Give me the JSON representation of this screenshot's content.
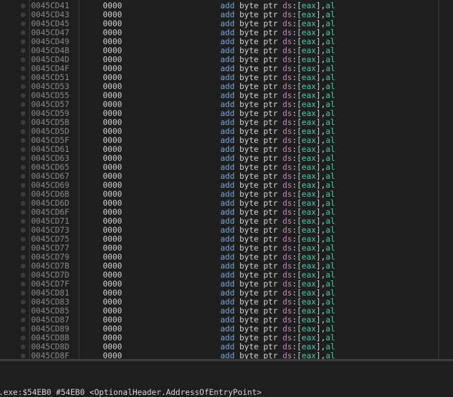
{
  "disassembly": {
    "rows": [
      {
        "address": "0045CD41",
        "bytes": "0000",
        "mnemonic": "add",
        "size": "byte",
        "ptr": "ptr",
        "segment": "ds",
        "reg": "eax",
        "src": "al"
      },
      {
        "address": "0045CD43",
        "bytes": "0000",
        "mnemonic": "add",
        "size": "byte",
        "ptr": "ptr",
        "segment": "ds",
        "reg": "eax",
        "src": "al"
      },
      {
        "address": "0045CD45",
        "bytes": "0000",
        "mnemonic": "add",
        "size": "byte",
        "ptr": "ptr",
        "segment": "ds",
        "reg": "eax",
        "src": "al"
      },
      {
        "address": "0045CD47",
        "bytes": "0000",
        "mnemonic": "add",
        "size": "byte",
        "ptr": "ptr",
        "segment": "ds",
        "reg": "eax",
        "src": "al"
      },
      {
        "address": "0045CD49",
        "bytes": "0000",
        "mnemonic": "add",
        "size": "byte",
        "ptr": "ptr",
        "segment": "ds",
        "reg": "eax",
        "src": "al"
      },
      {
        "address": "0045CD4B",
        "bytes": "0000",
        "mnemonic": "add",
        "size": "byte",
        "ptr": "ptr",
        "segment": "ds",
        "reg": "eax",
        "src": "al"
      },
      {
        "address": "0045CD4D",
        "bytes": "0000",
        "mnemonic": "add",
        "size": "byte",
        "ptr": "ptr",
        "segment": "ds",
        "reg": "eax",
        "src": "al"
      },
      {
        "address": "0045CD4F",
        "bytes": "0000",
        "mnemonic": "add",
        "size": "byte",
        "ptr": "ptr",
        "segment": "ds",
        "reg": "eax",
        "src": "al"
      },
      {
        "address": "0045CD51",
        "bytes": "0000",
        "mnemonic": "add",
        "size": "byte",
        "ptr": "ptr",
        "segment": "ds",
        "reg": "eax",
        "src": "al"
      },
      {
        "address": "0045CD53",
        "bytes": "0000",
        "mnemonic": "add",
        "size": "byte",
        "ptr": "ptr",
        "segment": "ds",
        "reg": "eax",
        "src": "al"
      },
      {
        "address": "0045CD55",
        "bytes": "0000",
        "mnemonic": "add",
        "size": "byte",
        "ptr": "ptr",
        "segment": "ds",
        "reg": "eax",
        "src": "al"
      },
      {
        "address": "0045CD57",
        "bytes": "0000",
        "mnemonic": "add",
        "size": "byte",
        "ptr": "ptr",
        "segment": "ds",
        "reg": "eax",
        "src": "al"
      },
      {
        "address": "0045CD59",
        "bytes": "0000",
        "mnemonic": "add",
        "size": "byte",
        "ptr": "ptr",
        "segment": "ds",
        "reg": "eax",
        "src": "al"
      },
      {
        "address": "0045CD5B",
        "bytes": "0000",
        "mnemonic": "add",
        "size": "byte",
        "ptr": "ptr",
        "segment": "ds",
        "reg": "eax",
        "src": "al"
      },
      {
        "address": "0045CD5D",
        "bytes": "0000",
        "mnemonic": "add",
        "size": "byte",
        "ptr": "ptr",
        "segment": "ds",
        "reg": "eax",
        "src": "al"
      },
      {
        "address": "0045CD5F",
        "bytes": "0000",
        "mnemonic": "add",
        "size": "byte",
        "ptr": "ptr",
        "segment": "ds",
        "reg": "eax",
        "src": "al"
      },
      {
        "address": "0045CD61",
        "bytes": "0000",
        "mnemonic": "add",
        "size": "byte",
        "ptr": "ptr",
        "segment": "ds",
        "reg": "eax",
        "src": "al"
      },
      {
        "address": "0045CD63",
        "bytes": "0000",
        "mnemonic": "add",
        "size": "byte",
        "ptr": "ptr",
        "segment": "ds",
        "reg": "eax",
        "src": "al"
      },
      {
        "address": "0045CD65",
        "bytes": "0000",
        "mnemonic": "add",
        "size": "byte",
        "ptr": "ptr",
        "segment": "ds",
        "reg": "eax",
        "src": "al"
      },
      {
        "address": "0045CD67",
        "bytes": "0000",
        "mnemonic": "add",
        "size": "byte",
        "ptr": "ptr",
        "segment": "ds",
        "reg": "eax",
        "src": "al"
      },
      {
        "address": "0045CD69",
        "bytes": "0000",
        "mnemonic": "add",
        "size": "byte",
        "ptr": "ptr",
        "segment": "ds",
        "reg": "eax",
        "src": "al"
      },
      {
        "address": "0045CD6B",
        "bytes": "0000",
        "mnemonic": "add",
        "size": "byte",
        "ptr": "ptr",
        "segment": "ds",
        "reg": "eax",
        "src": "al"
      },
      {
        "address": "0045CD6D",
        "bytes": "0000",
        "mnemonic": "add",
        "size": "byte",
        "ptr": "ptr",
        "segment": "ds",
        "reg": "eax",
        "src": "al"
      },
      {
        "address": "0045CD6F",
        "bytes": "0000",
        "mnemonic": "add",
        "size": "byte",
        "ptr": "ptr",
        "segment": "ds",
        "reg": "eax",
        "src": "al"
      },
      {
        "address": "0045CD71",
        "bytes": "0000",
        "mnemonic": "add",
        "size": "byte",
        "ptr": "ptr",
        "segment": "ds",
        "reg": "eax",
        "src": "al"
      },
      {
        "address": "0045CD73",
        "bytes": "0000",
        "mnemonic": "add",
        "size": "byte",
        "ptr": "ptr",
        "segment": "ds",
        "reg": "eax",
        "src": "al"
      },
      {
        "address": "0045CD75",
        "bytes": "0000",
        "mnemonic": "add",
        "size": "byte",
        "ptr": "ptr",
        "segment": "ds",
        "reg": "eax",
        "src": "al"
      },
      {
        "address": "0045CD77",
        "bytes": "0000",
        "mnemonic": "add",
        "size": "byte",
        "ptr": "ptr",
        "segment": "ds",
        "reg": "eax",
        "src": "al"
      },
      {
        "address": "0045CD79",
        "bytes": "0000",
        "mnemonic": "add",
        "size": "byte",
        "ptr": "ptr",
        "segment": "ds",
        "reg": "eax",
        "src": "al"
      },
      {
        "address": "0045CD7B",
        "bytes": "0000",
        "mnemonic": "add",
        "size": "byte",
        "ptr": "ptr",
        "segment": "ds",
        "reg": "eax",
        "src": "al"
      },
      {
        "address": "0045CD7D",
        "bytes": "0000",
        "mnemonic": "add",
        "size": "byte",
        "ptr": "ptr",
        "segment": "ds",
        "reg": "eax",
        "src": "al"
      },
      {
        "address": "0045CD7F",
        "bytes": "0000",
        "mnemonic": "add",
        "size": "byte",
        "ptr": "ptr",
        "segment": "ds",
        "reg": "eax",
        "src": "al"
      },
      {
        "address": "0045CD81",
        "bytes": "0000",
        "mnemonic": "add",
        "size": "byte",
        "ptr": "ptr",
        "segment": "ds",
        "reg": "eax",
        "src": "al"
      },
      {
        "address": "0045CD83",
        "bytes": "0000",
        "mnemonic": "add",
        "size": "byte",
        "ptr": "ptr",
        "segment": "ds",
        "reg": "eax",
        "src": "al"
      },
      {
        "address": "0045CD85",
        "bytes": "0000",
        "mnemonic": "add",
        "size": "byte",
        "ptr": "ptr",
        "segment": "ds",
        "reg": "eax",
        "src": "al"
      },
      {
        "address": "0045CD87",
        "bytes": "0000",
        "mnemonic": "add",
        "size": "byte",
        "ptr": "ptr",
        "segment": "ds",
        "reg": "eax",
        "src": "al"
      },
      {
        "address": "0045CD89",
        "bytes": "0000",
        "mnemonic": "add",
        "size": "byte",
        "ptr": "ptr",
        "segment": "ds",
        "reg": "eax",
        "src": "al"
      },
      {
        "address": "0045CD8B",
        "bytes": "0000",
        "mnemonic": "add",
        "size": "byte",
        "ptr": "ptr",
        "segment": "ds",
        "reg": "eax",
        "src": "al"
      },
      {
        "address": "0045CD8D",
        "bytes": "0000",
        "mnemonic": "add",
        "size": "byte",
        "ptr": "ptr",
        "segment": "ds",
        "reg": "eax",
        "src": "al"
      },
      {
        "address": "0045CD8F",
        "bytes": "0000",
        "mnemonic": "add",
        "size": "byte",
        "ptr": "ptr",
        "segment": "ds",
        "reg": "eax",
        "src": "al"
      }
    ]
  },
  "statusbar": {
    "text": ".exe:$54EB0 #54EB0 <OptionalHeader.AddressOfEntryPoint>"
  },
  "colors": {
    "background": "#1e1e1e",
    "address": "#8a8a8a",
    "mnemonic": "#7aa6da",
    "segment": "#c586c0",
    "register": "#4ec9b0",
    "text": "#d4d4d4"
  }
}
